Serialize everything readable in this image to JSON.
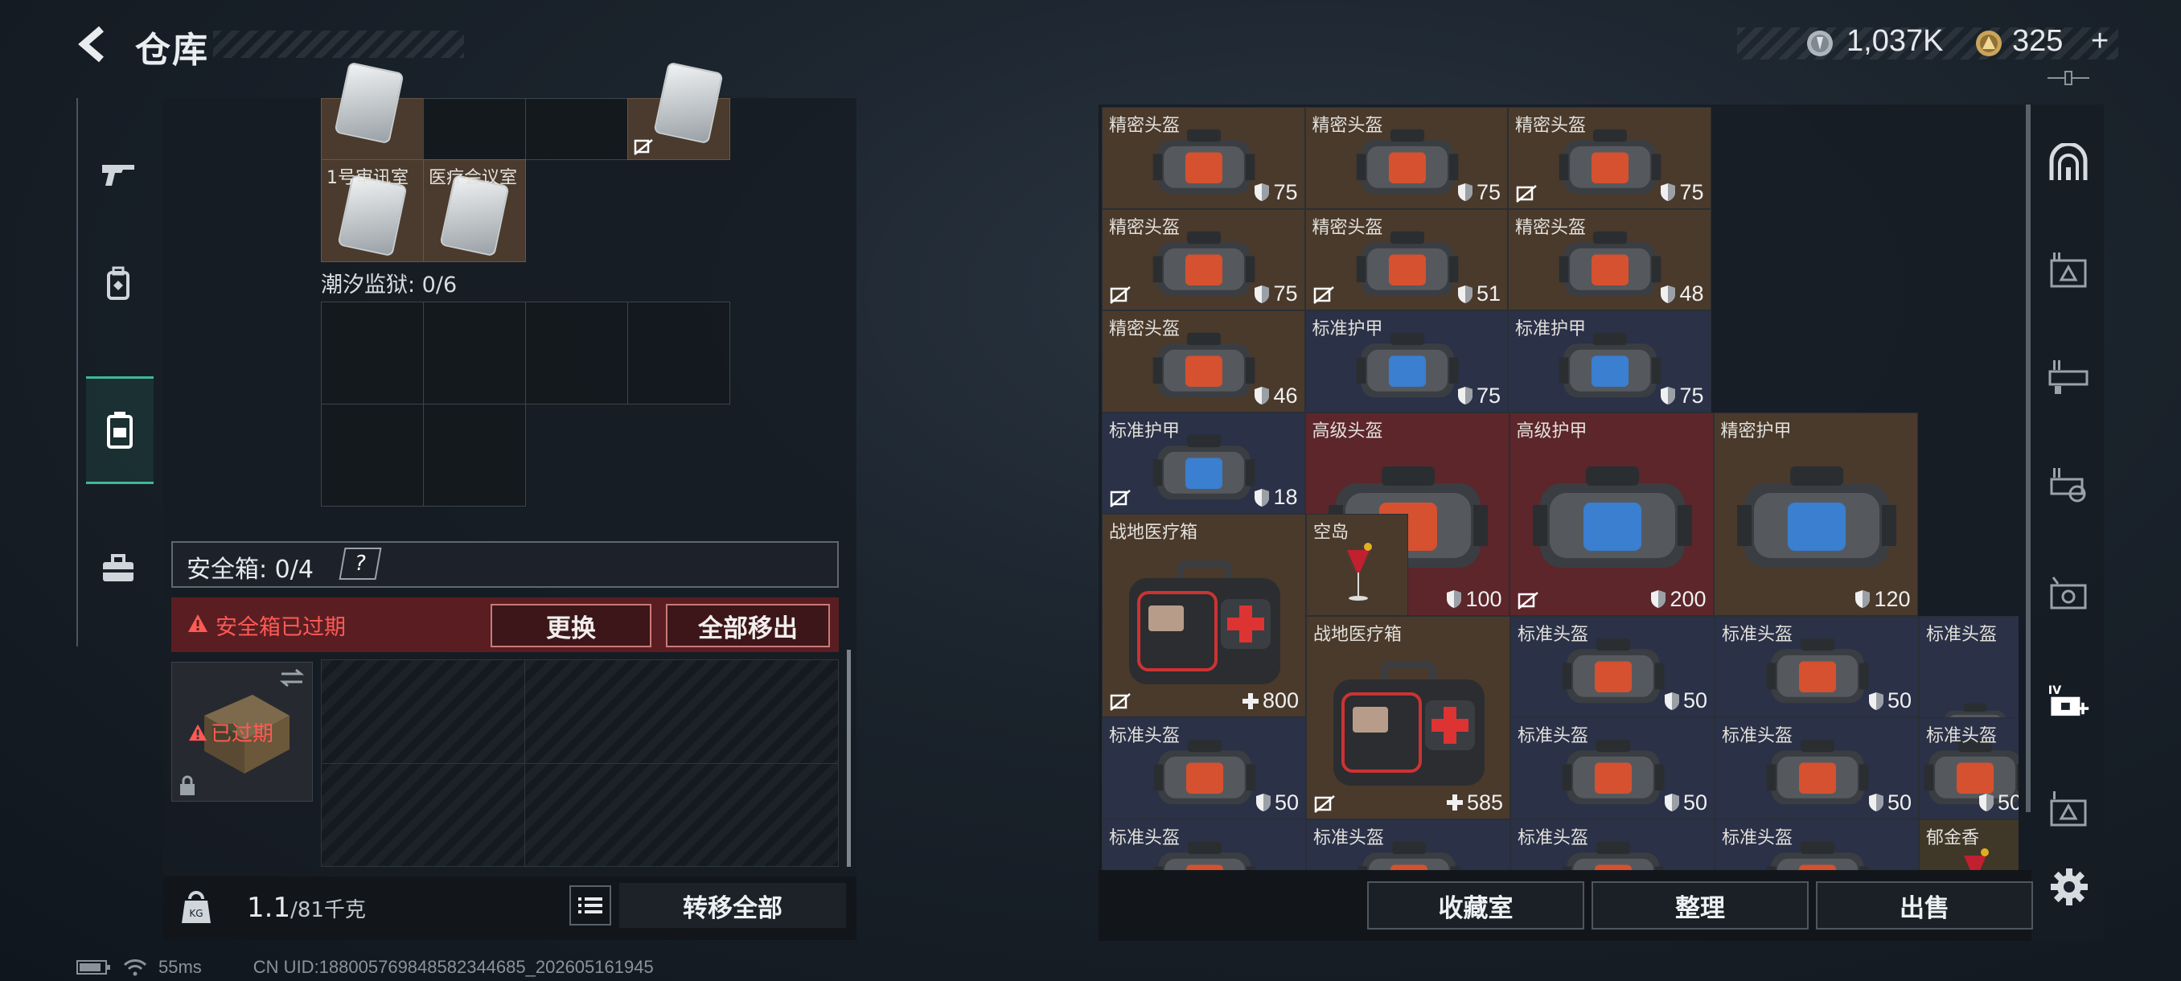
{
  "header": {
    "title": "仓库",
    "currency": [
      {
        "icon": "silver-coin-icon",
        "value": "1,037K"
      },
      {
        "icon": "gold-coin-icon",
        "value": "325"
      }
    ],
    "add_label": "+"
  },
  "left_nav": {
    "items": [
      {
        "name": "weapon",
        "icon": "gun-icon"
      },
      {
        "name": "armor",
        "icon": "backpack-icon"
      },
      {
        "name": "container",
        "icon": "container-icon",
        "active": true
      },
      {
        "name": "toolbox",
        "icon": "toolbox-icon"
      }
    ]
  },
  "keycards": {
    "cards": [
      {
        "label": "1号审讯室"
      },
      {
        "label": "医疗会议室"
      }
    ],
    "prison_label": "潮汐监狱: 0/6"
  },
  "safe_box": {
    "label": "安全箱: 0/4",
    "help": "?",
    "expired_message": "安全箱已过期",
    "replace_label": "更换",
    "move_out_all_label": "全部移出",
    "thumb_badge": "已过期"
  },
  "left_bottom": {
    "weight_value": "1.1",
    "weight_capacity": "/81千克",
    "transfer_all_label": "转移全部"
  },
  "footer": {
    "ping": "55ms",
    "uid": "CN UID:18800576984858234​4685_202605161945"
  },
  "storage": {
    "items": [
      {
        "label": "精密头盔",
        "value": "75",
        "kind": "helmet",
        "theme": "brown"
      },
      {
        "label": "精密头盔",
        "value": "75",
        "kind": "helmet",
        "theme": "brown"
      },
      {
        "label": "精密头盔",
        "value": "75",
        "kind": "helmet",
        "theme": "brown",
        "noxfer": true
      },
      {
        "label": "精密头盔",
        "value": "75",
        "kind": "helmet",
        "theme": "brown",
        "noxfer": true
      },
      {
        "label": "精密头盔",
        "value": "51",
        "kind": "helmet",
        "theme": "brown",
        "noxfer": true
      },
      {
        "label": "精密头盔",
        "value": "48",
        "kind": "helmet",
        "theme": "brown"
      },
      {
        "label": "精密头盔",
        "value": "46",
        "kind": "helmet",
        "theme": "brown"
      },
      {
        "label": "标准护甲",
        "value": "75",
        "kind": "armor",
        "theme": "navy"
      },
      {
        "label": "标准护甲",
        "value": "75",
        "kind": "armor",
        "theme": "navy"
      },
      {
        "label": "标准护甲",
        "value": "18",
        "kind": "armor",
        "theme": "navy",
        "noxfer": true
      },
      {
        "label": "高级头盔",
        "value": "100",
        "kind": "helmet",
        "theme": "red"
      },
      {
        "label": "高级护甲",
        "value": "200",
        "kind": "armor",
        "theme": "red",
        "noxfer": true
      },
      {
        "label": "精密护甲",
        "value": "120",
        "kind": "armor",
        "theme": "brown"
      },
      {
        "label": "战地医疗箱",
        "value": "800",
        "kind": "medkit",
        "theme": "brown",
        "noxfer": true
      },
      {
        "label": "空岛",
        "value": "",
        "kind": "drink",
        "theme": "brown"
      },
      {
        "label": "战地医疗箱",
        "value": "585",
        "kind": "medkit",
        "theme": "brown",
        "noxfer": true
      },
      {
        "label": "标准头盔",
        "value": "50",
        "kind": "helmet",
        "theme": "navy"
      },
      {
        "label": "标准头盔",
        "value": "50",
        "kind": "helmet",
        "theme": "navy"
      },
      {
        "label": "标准头盔",
        "value": "",
        "kind": "helmet-side",
        "theme": "navy"
      },
      {
        "label": "标准头盔",
        "value": "50",
        "kind": "helmet",
        "theme": "navy"
      },
      {
        "label": "标准头盔",
        "value": "50",
        "kind": "helmet",
        "theme": "navy"
      },
      {
        "label": "标准头盔",
        "value": "50",
        "kind": "helmet",
        "theme": "navy"
      },
      {
        "label": "标准头盔",
        "value": "50",
        "kind": "helmet",
        "theme": "navy"
      },
      {
        "label": "标准头盔",
        "value": "",
        "kind": "helmet",
        "theme": "navy"
      },
      {
        "label": "标准头盔",
        "value": "",
        "kind": "helmet",
        "theme": "navy"
      },
      {
        "label": "标准头盔",
        "value": "",
        "kind": "helmet",
        "theme": "navy"
      },
      {
        "label": "标准头盔",
        "value": "",
        "kind": "helmet",
        "theme": "navy"
      },
      {
        "label": "郁金香",
        "value": "",
        "kind": "drink",
        "theme": "olive"
      }
    ]
  },
  "right_bottom": {
    "collection_label": "收藏室",
    "sort_label": "整理",
    "sell_label": "出售"
  },
  "right_nav": {
    "items": [
      {
        "icon": "vault-icon"
      },
      {
        "icon": "storage-tab-1-icon"
      },
      {
        "icon": "storage-tab-2-icon"
      },
      {
        "icon": "storage-tab-3-icon"
      },
      {
        "icon": "storage-tab-4-icon"
      },
      {
        "icon": "add-storage-tab-icon",
        "badge": "IV"
      },
      {
        "icon": "storage-tab-5-icon"
      }
    ],
    "settings_icon": "gear-icon"
  },
  "colors": {
    "accent": "#3fb79a",
    "danger": "#ff5a55",
    "danger_bg": "#5a1e22"
  }
}
